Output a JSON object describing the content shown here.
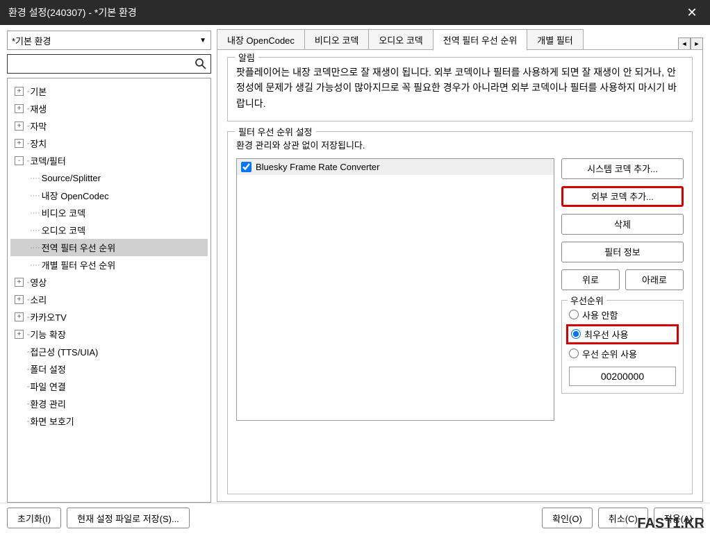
{
  "window": {
    "title": "환경 설정(240307) - *기본 환경"
  },
  "env_selector": {
    "value": "*기본 환경"
  },
  "search": {
    "placeholder": ""
  },
  "tree": [
    {
      "label": "기본",
      "level": 1,
      "expander": "+"
    },
    {
      "label": "재생",
      "level": 1,
      "expander": "+"
    },
    {
      "label": "자막",
      "level": 1,
      "expander": "+"
    },
    {
      "label": "장치",
      "level": 1,
      "expander": "+"
    },
    {
      "label": "코덱/필터",
      "level": 1,
      "expander": "-"
    },
    {
      "label": "Source/Splitter",
      "level": 2
    },
    {
      "label": "내장 OpenCodec",
      "level": 2
    },
    {
      "label": "비디오 코덱",
      "level": 2
    },
    {
      "label": "오디오 코덱",
      "level": 2
    },
    {
      "label": "전역 필터 우선 순위",
      "level": 2,
      "selected": true
    },
    {
      "label": "개별 필터 우선 순위",
      "level": 2
    },
    {
      "label": "영상",
      "level": 1,
      "expander": "+"
    },
    {
      "label": "소리",
      "level": 1,
      "expander": "+"
    },
    {
      "label": "카카오TV",
      "level": 1,
      "expander": "+"
    },
    {
      "label": "기능 확장",
      "level": 1,
      "expander": "+"
    },
    {
      "label": "접근성 (TTS/UIA)",
      "level": 1,
      "noexpand": true
    },
    {
      "label": "폴더 설정",
      "level": 1,
      "noexpand": true
    },
    {
      "label": "파일 연결",
      "level": 1,
      "noexpand": true
    },
    {
      "label": "환경 관리",
      "level": 1,
      "noexpand": true
    },
    {
      "label": "화면 보호기",
      "level": 1,
      "noexpand": true
    }
  ],
  "tabs": {
    "items": [
      {
        "label": "내장 OpenCodec"
      },
      {
        "label": "비디오 코덱"
      },
      {
        "label": "오디오 코덱"
      },
      {
        "label": "전역 필터 우선 순위",
        "active": true
      },
      {
        "label": "개별 필터"
      }
    ]
  },
  "notice": {
    "legend": "알림",
    "text": "팟플레이어는 내장 코덱만으로 잘 재생이 됩니다. 외부 코덱이나 필터를 사용하게 되면 잘 재생이 안 되거나, 안정성에 문제가 생길 가능성이 많아지므로 꼭 필요한 경우가 아니라면 외부 코덱이나 필터를 사용하지 마시기 바랍니다."
  },
  "filter_settings": {
    "legend": "필터 우선 순위 설정",
    "subtitle": "환경 관리와 상관 없이 저장됩니다.",
    "items": [
      {
        "label": "Bluesky Frame Rate Converter",
        "checked": true
      }
    ],
    "buttons": {
      "add_system": "시스템 코덱 추가...",
      "add_external": "외부 코덱 추가...",
      "delete": "삭제",
      "filter_info": "필터 정보",
      "move_up": "위로",
      "move_down": "아래로"
    },
    "priority": {
      "legend": "우선순위",
      "opt_none": "사용 안함",
      "opt_highest": "최우선 사용",
      "opt_custom": "우선 순위 사용",
      "value": "00200000"
    }
  },
  "bottom": {
    "reset": "초기화(I)",
    "save_as": "현재 설정 파일로 저장(S)...",
    "ok": "확인(O)",
    "cancel": "취소(C)",
    "apply": "적용(A)"
  },
  "watermark": "FAST1.KR"
}
